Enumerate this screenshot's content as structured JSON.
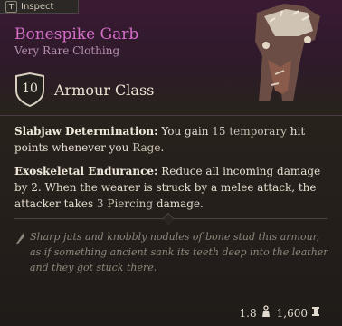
{
  "inspect": {
    "key": "T",
    "label": "Inspect"
  },
  "item": {
    "name": "Bonespike Garb",
    "rarity": "Very Rare Clothing",
    "rarity_color": "#d36ec7",
    "armour_class": {
      "value": "10",
      "label": "Armour Class"
    }
  },
  "effects": [
    {
      "name": "Slabjaw Determination:",
      "text1": " You gain ",
      "hl": "15 temporary",
      "text2": " hit points whenever you ",
      "hl2": "Rage",
      "text3": "."
    },
    {
      "name": "Exoskeletal Endurance:",
      "text1": " Reduce all incoming damage by 2. When the wearer is struck by a melee attack, the attacker takes ",
      "hl": "3 Piercing",
      "text2": " damage."
    }
  ],
  "flavour": "Sharp juts and knobbly nodules of bone stud this armour, as if something ancient sank its teeth deep into the leather and they got stuck there.",
  "footer": {
    "weight": "1.8",
    "weight_icon": "weight-icon",
    "value": "1,600",
    "value_icon": "gold-icon"
  }
}
